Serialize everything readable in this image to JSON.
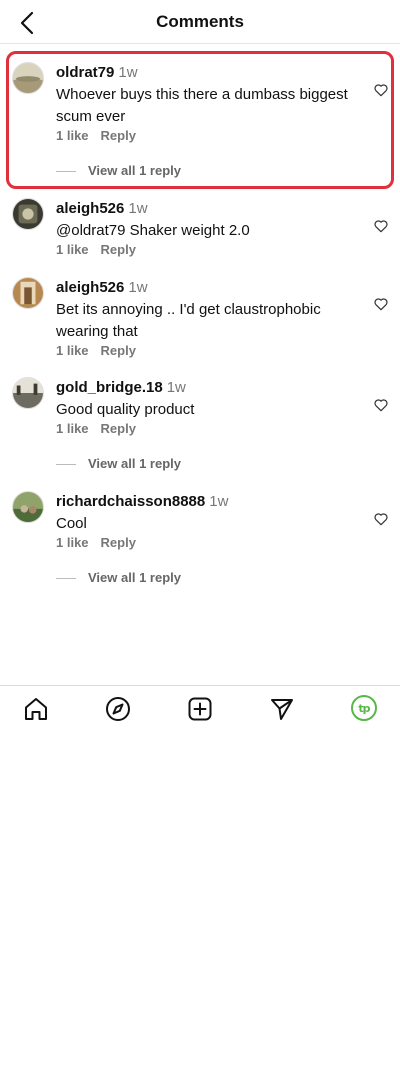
{
  "header": {
    "title": "Comments",
    "back_icon": "chevron-left-icon"
  },
  "comments": [
    {
      "username": "oldrat79",
      "time": "1w",
      "text": "Whoever buys this there a dumbass biggest scum ever",
      "likes": "1 like",
      "reply_label": "Reply",
      "view_replies": "View all 1 reply",
      "highlighted": true
    },
    {
      "username": "aleigh526",
      "time": "1w",
      "text": "@oldrat79 Shaker weight 2.0",
      "likes": "1 like",
      "reply_label": "Reply"
    },
    {
      "username": "aleigh526",
      "time": "1w",
      "text": "Bet its annoying .. I'd get claustrophobic wearing that",
      "likes": "1 like",
      "reply_label": "Reply"
    },
    {
      "username": "gold_bridge.18",
      "time": "1w",
      "text": "Good quality product",
      "likes": "1 like",
      "reply_label": "Reply",
      "view_replies": "View all 1 reply"
    },
    {
      "username": "richardchaisson8888",
      "time": "1w",
      "text": "Cool",
      "likes": "1 like",
      "reply_label": "Reply",
      "view_replies": "View all 1 reply"
    }
  ],
  "tabbar": {
    "items": [
      "home-icon",
      "explore-compass-icon",
      "create-plus-icon",
      "send-icon",
      "profile-avatar"
    ],
    "profile_initials": "tp"
  },
  "colors": {
    "highlight": "#e0303e",
    "profile_accent": "#58b847",
    "muted": "#777777"
  }
}
